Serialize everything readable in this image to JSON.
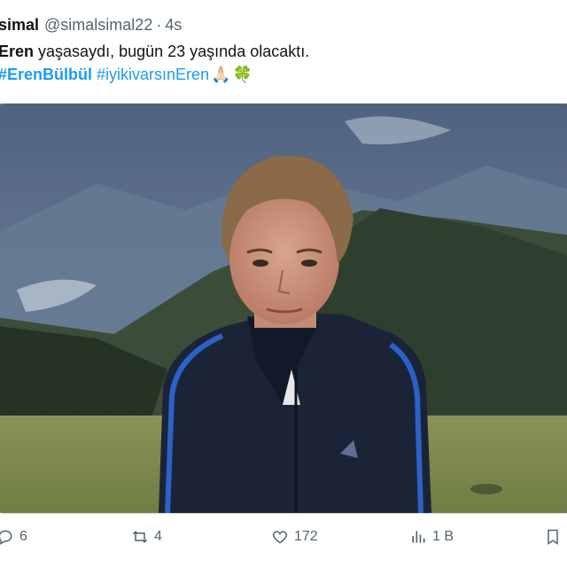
{
  "tweet": {
    "display_name": "simal",
    "handle": "@simalsimal22",
    "separator": "·",
    "time": "4s",
    "text_mention": "Eren",
    "text_body": " yaşasaydı, bugün 23 yaşında olacaktı.",
    "hashtag1": "#ErenBülbül",
    "hashtag2": "#iyikivarsınEren",
    "emoji1": "🙏🏻",
    "emoji2": "🍀",
    "image": {
      "subject": "boy in dark blue track jacket in front of green mountains",
      "colors": {
        "sky": "#5d6f86",
        "forest": "#31412f",
        "meadow": "#7d8a51",
        "jacket": "#1b2437",
        "stripe": "#2a62c8"
      }
    }
  },
  "actions": {
    "replies": "6",
    "reposts": "4",
    "likes": "172",
    "views": "1 B"
  },
  "colors": {
    "link": "#1d9bf0",
    "muted": "#536471",
    "text": "#0f1419"
  }
}
